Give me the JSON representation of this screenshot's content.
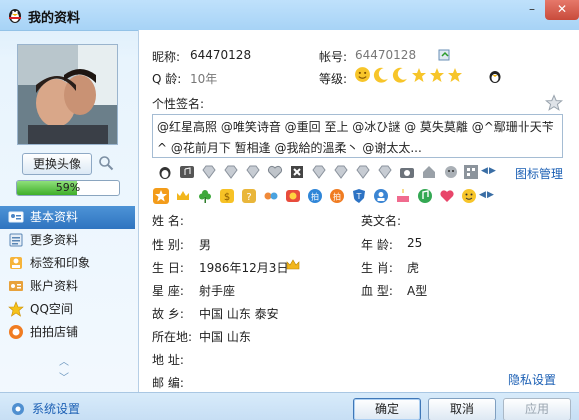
{
  "window": {
    "title": "我的资料"
  },
  "titlebar": {
    "min_label": "–",
    "close_label": "✕"
  },
  "left": {
    "change_avatar_label": "更换头像",
    "progress": {
      "value": 0.59,
      "label": "59%"
    },
    "nav": [
      {
        "label": "基本资料",
        "icon": "id-card-icon",
        "active": true
      },
      {
        "label": "更多资料",
        "icon": "list-icon",
        "active": false
      },
      {
        "label": "标签和印象",
        "icon": "tag-icon",
        "active": false
      },
      {
        "label": "账户资料",
        "icon": "account-icon",
        "active": false
      },
      {
        "label": "QQ空间",
        "icon": "star-space-icon",
        "active": false
      },
      {
        "label": "拍拍店铺",
        "icon": "shop-icon",
        "active": false
      }
    ],
    "scroll_up": "︿",
    "scroll_down": "﹀"
  },
  "main": {
    "nickname_label": "昵称:",
    "nickname": "64470128",
    "account_label": "帐号:",
    "account": "64470128",
    "qage_label": "Q 龄:",
    "qage": "10年",
    "level_label": "等级:",
    "signature_label": "个性签名:",
    "signature": "@红星高照 @唯笑诗音 @重回 至上  @冰ひ謎  @    莫失莫離 @^鄢珊卝天苄^ @花前月下 暂相逢  @我給的溫柔丶  @谢太太...",
    "icon_manage_label": "图标管理",
    "fields": {
      "name_label": "姓    名:",
      "name": "",
      "english_name_label": "英文名:",
      "english_name": "",
      "gender_label": "性    别:",
      "gender": "男",
      "age_label": "年    龄:",
      "age": "25",
      "birthday_label": "生    日:",
      "birthday": "1986年12月3日",
      "zodiac_label": "生    肖:",
      "zodiac": "虎",
      "star_sign_label": "星    座:",
      "star_sign": "射手座",
      "blood_label": "血    型:",
      "blood": "A型",
      "hometown_label": "故    乡:",
      "hometown": "中国  山东  泰安",
      "location_label": "所在地:",
      "location": "中国  山东",
      "address_label": "地    址:",
      "address": "",
      "postcode_label": "邮    编:",
      "postcode": ""
    },
    "privacy_label": "隐私设置"
  },
  "bottom": {
    "system_settings_label": "系统设置",
    "ok_label": "确定",
    "cancel_label": "取消",
    "apply_label": "应用"
  },
  "colors": {
    "accent": "#2f74c0",
    "link": "#1b5fb4",
    "progress": "#3fae2a"
  }
}
